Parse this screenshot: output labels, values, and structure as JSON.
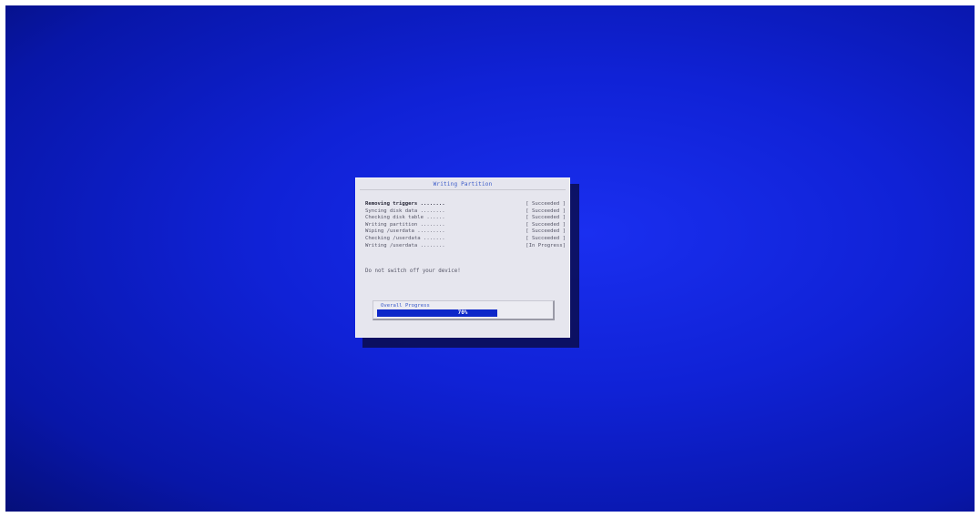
{
  "dialog": {
    "title": "Writing Partition",
    "steps": [
      {
        "name": "Removing triggers ........",
        "status": "[ Succeeded ]"
      },
      {
        "name": "Syncing disk data ........",
        "status": "[ Succeeded ]"
      },
      {
        "name": "Checking disk table ......",
        "status": "[ Succeeded ]"
      },
      {
        "name": "Writing partition ........",
        "status": "[ Succeeded ]"
      },
      {
        "name": "Wiping /userdata .........",
        "status": "[ Succeeded ]"
      },
      {
        "name": "Checking /userdata .......",
        "status": "[ Succeeded ]"
      },
      {
        "name": "Writing /userdata ........",
        "status": "[In Progress]"
      }
    ],
    "warning": "Do not switch off your device!",
    "progress": {
      "label": "Overall Progress",
      "percent_text": "70%",
      "fraction": 0.7
    }
  },
  "colors": {
    "screen_background": "#1022d6",
    "dialog_background": "#e6e6ee",
    "accent": "#3a5ac8",
    "progress_fill": "#0d27c9"
  }
}
